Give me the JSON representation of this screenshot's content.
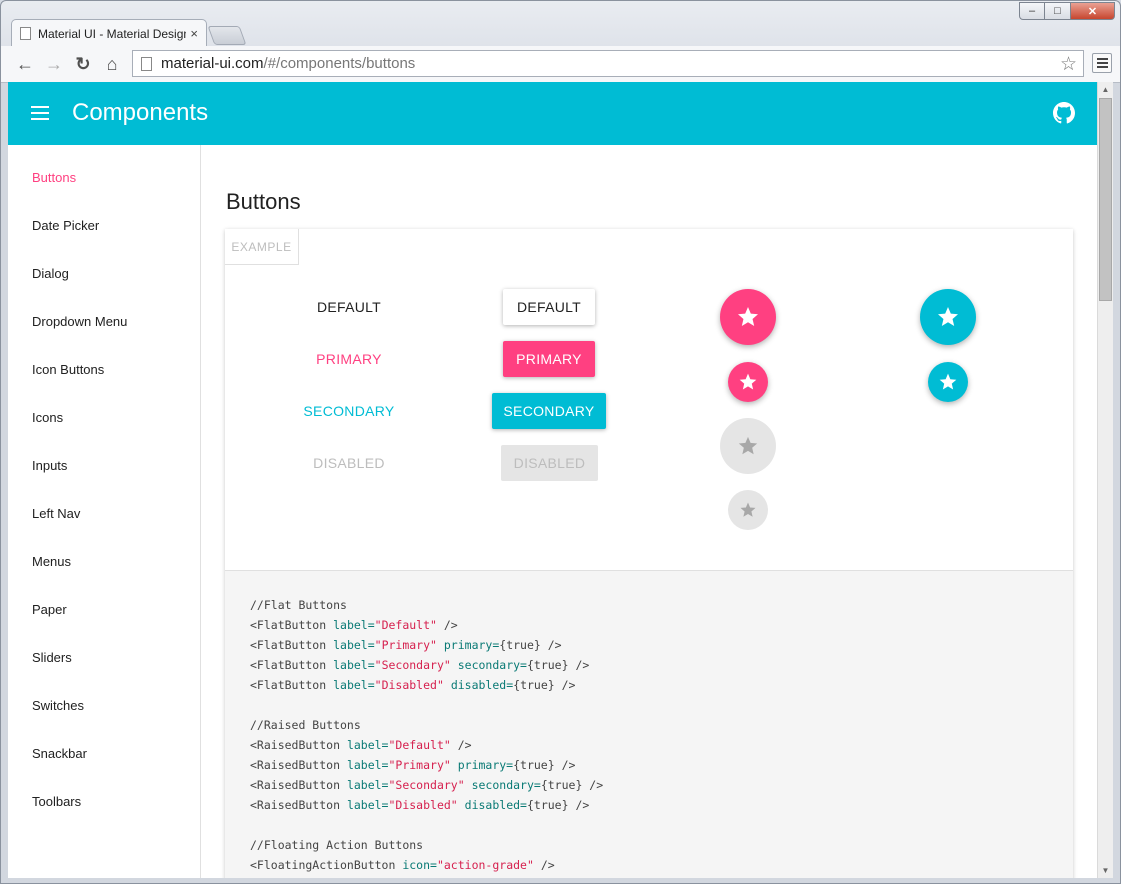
{
  "browser": {
    "tab_title": "Material UI - Material Design",
    "tab_close": "×",
    "url_host": "material-ui.com",
    "url_path": "/#/components/buttons",
    "back_glyph": "←",
    "forward_glyph": "→",
    "reload_glyph": "↻",
    "home_glyph": "⌂",
    "star_glyph": "☆",
    "min_glyph": "–",
    "max_glyph": "□",
    "close_glyph": "✕"
  },
  "appbar": {
    "title": "Components",
    "menu_icon": "hamburger-icon",
    "github_icon": "github-icon",
    "color": "#00bcd4"
  },
  "sidebar": {
    "items": [
      {
        "label": "Buttons",
        "active": true
      },
      {
        "label": "Date Picker"
      },
      {
        "label": "Dialog"
      },
      {
        "label": "Dropdown Menu"
      },
      {
        "label": "Icon Buttons"
      },
      {
        "label": "Icons"
      },
      {
        "label": "Inputs"
      },
      {
        "label": "Left Nav"
      },
      {
        "label": "Menus"
      },
      {
        "label": "Paper"
      },
      {
        "label": "Sliders"
      },
      {
        "label": "Switches"
      },
      {
        "label": "Snackbar"
      },
      {
        "label": "Toolbars"
      }
    ]
  },
  "main": {
    "page_title": "Buttons",
    "example_tab": "EXAMPLE",
    "flat_buttons": [
      {
        "label": "DEFAULT"
      },
      {
        "label": "PRIMARY"
      },
      {
        "label": "SECONDARY"
      },
      {
        "label": "DISABLED"
      }
    ],
    "raised_buttons": [
      {
        "label": "DEFAULT"
      },
      {
        "label": "PRIMARY"
      },
      {
        "label": "SECONDARY"
      },
      {
        "label": "DISABLED"
      }
    ],
    "fab_icon": "star-icon",
    "colors": {
      "primary": "#ff4081",
      "secondary": "#00bcd4",
      "disabled_bg": "#e5e5e5",
      "disabled_text": "#bdbdbd"
    },
    "code": [
      [
        [
          "c",
          "//Flat Buttons"
        ]
      ],
      [
        [
          "t",
          "<FlatButton "
        ],
        [
          "a",
          "label="
        ],
        [
          "s",
          "\"Default\""
        ],
        [
          "t",
          " />"
        ]
      ],
      [
        [
          "t",
          "<FlatButton "
        ],
        [
          "a",
          "label="
        ],
        [
          "s",
          "\"Primary\""
        ],
        [
          "a",
          " primary="
        ],
        [
          "t",
          "{true} />"
        ]
      ],
      [
        [
          "t",
          "<FlatButton "
        ],
        [
          "a",
          "label="
        ],
        [
          "s",
          "\"Secondary\""
        ],
        [
          "a",
          " secondary="
        ],
        [
          "t",
          "{true} />"
        ]
      ],
      [
        [
          "t",
          "<FlatButton "
        ],
        [
          "a",
          "label="
        ],
        [
          "s",
          "\"Disabled\""
        ],
        [
          "a",
          " disabled="
        ],
        [
          "t",
          "{true} />"
        ]
      ],
      [],
      [
        [
          "c",
          "//Raised Buttons"
        ]
      ],
      [
        [
          "t",
          "<RaisedButton "
        ],
        [
          "a",
          "label="
        ],
        [
          "s",
          "\"Default\""
        ],
        [
          "t",
          " />"
        ]
      ],
      [
        [
          "t",
          "<RaisedButton "
        ],
        [
          "a",
          "label="
        ],
        [
          "s",
          "\"Primary\""
        ],
        [
          "a",
          " primary="
        ],
        [
          "t",
          "{true} />"
        ]
      ],
      [
        [
          "t",
          "<RaisedButton "
        ],
        [
          "a",
          "label="
        ],
        [
          "s",
          "\"Secondary\""
        ],
        [
          "a",
          " secondary="
        ],
        [
          "t",
          "{true} />"
        ]
      ],
      [
        [
          "t",
          "<RaisedButton "
        ],
        [
          "a",
          "label="
        ],
        [
          "s",
          "\"Disabled\""
        ],
        [
          "a",
          " disabled="
        ],
        [
          "t",
          "{true} />"
        ]
      ],
      [],
      [
        [
          "c",
          "//Floating Action Buttons"
        ]
      ],
      [
        [
          "t",
          "<FloatingActionButton "
        ],
        [
          "a",
          "icon="
        ],
        [
          "s",
          "\"action-grade\""
        ],
        [
          "t",
          " />"
        ]
      ]
    ]
  }
}
